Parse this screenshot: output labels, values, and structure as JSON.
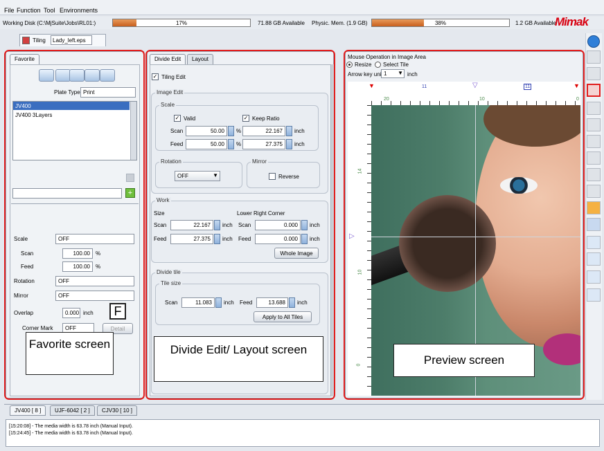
{
  "menu": [
    "File",
    "Function",
    "Tool",
    "Environments"
  ],
  "status": {
    "working_disk_label": "Working Disk (C:\\MjSuite\\Jobs\\RL01:)",
    "working_disk_percent": "17%",
    "working_disk_fraction": 0.17,
    "working_disk_available": "71.88 GB Available",
    "phys_mem_label": "Physic. Mem. (1.9 GB)",
    "phys_mem_percent": "38%",
    "phys_mem_fraction": 0.38,
    "phys_mem_available": "1.2 GB Available",
    "brand": "Mimak"
  },
  "document_tab": {
    "label": "Tiling",
    "filename": "Lady_left.eps"
  },
  "favorite": {
    "tab": "Favorite",
    "plate_type_label": "Plate Type",
    "plate_type_value": "Print",
    "list": [
      "JV400",
      "JV400 3Layers"
    ],
    "scale_label": "Scale",
    "scale_value": "OFF",
    "scan_label": "Scan",
    "scan_value": "100.00",
    "scan_unit": "%",
    "feed_label": "Feed",
    "feed_value": "100.00",
    "feed_unit": "%",
    "rotation_label": "Rotation",
    "rotation_value": "OFF",
    "mirror_label": "Mirror",
    "mirror_value": "OFF",
    "overlap_label": "Overlap",
    "overlap_value": "0.000",
    "overlap_unit": "inch",
    "orientation_glyph": "F",
    "corner_mark_label": "Corner Mark",
    "corner_mark_value": "OFF",
    "detail_button": "Detail"
  },
  "divide": {
    "tab_divide": "Divide Edit",
    "tab_layout": "Layout",
    "tiling_edit": "Tiling Edit",
    "image_edit": "Image Edit",
    "scale": "Scale",
    "valid": "Valid",
    "keep_ratio": "Keep Ratio",
    "scan": "Scan",
    "feed": "Feed",
    "scan_pct": "50.00",
    "feed_pct": "50.00",
    "pct_unit": "%",
    "scan_inch": "22.167",
    "feed_inch": "27.375",
    "inch": "inch",
    "rotation": "Rotation",
    "rotation_value": "OFF",
    "mirror": "Mirror",
    "reverse": "Reverse",
    "work": "Work",
    "size": "Size",
    "lower_right": "Lower Right Corner",
    "work_scan": "22.167",
    "work_feed": "27.375",
    "lr_scan": "0.000",
    "lr_feed": "0.000",
    "whole_image": "Whole Image",
    "divide_tile": "Divide tile",
    "tile_size": "Tile size",
    "tile_scan": "11.083",
    "tile_feed": "13.688",
    "apply_all": "Apply to All Tiles"
  },
  "preview": {
    "mouse_op": "Mouse Operation in Image Area",
    "resize": "Resize",
    "select_tile": "Select Tile",
    "arrow_key_unit": "Arrow key unit",
    "arrow_value": "1",
    "arrow_unit": "inch",
    "ruler_top": [
      "20",
      "10",
      "0"
    ],
    "ruler_marks": [
      "11",
      "11"
    ],
    "ruler_left": [
      "14",
      "10",
      "0"
    ]
  },
  "captions": {
    "favorite": "Favorite screen",
    "divide": "Divide Edit/ Layout screen",
    "preview": "Preview screen"
  },
  "printer_tabs": [
    "JV400 [ 8 ]",
    "UJF-6042 [ 2 ]",
    "CJV30 [ 10 ]"
  ],
  "log": [
    "[15:20:08] - The media width is 63.78 inch (Manual Input).",
    "[15:24:45] - The media width is 63.78 inch (Manual Input)."
  ],
  "colors": {
    "highlight": "#e11d1d",
    "progress": "#d2712e",
    "selection": "#3a6ec0"
  }
}
